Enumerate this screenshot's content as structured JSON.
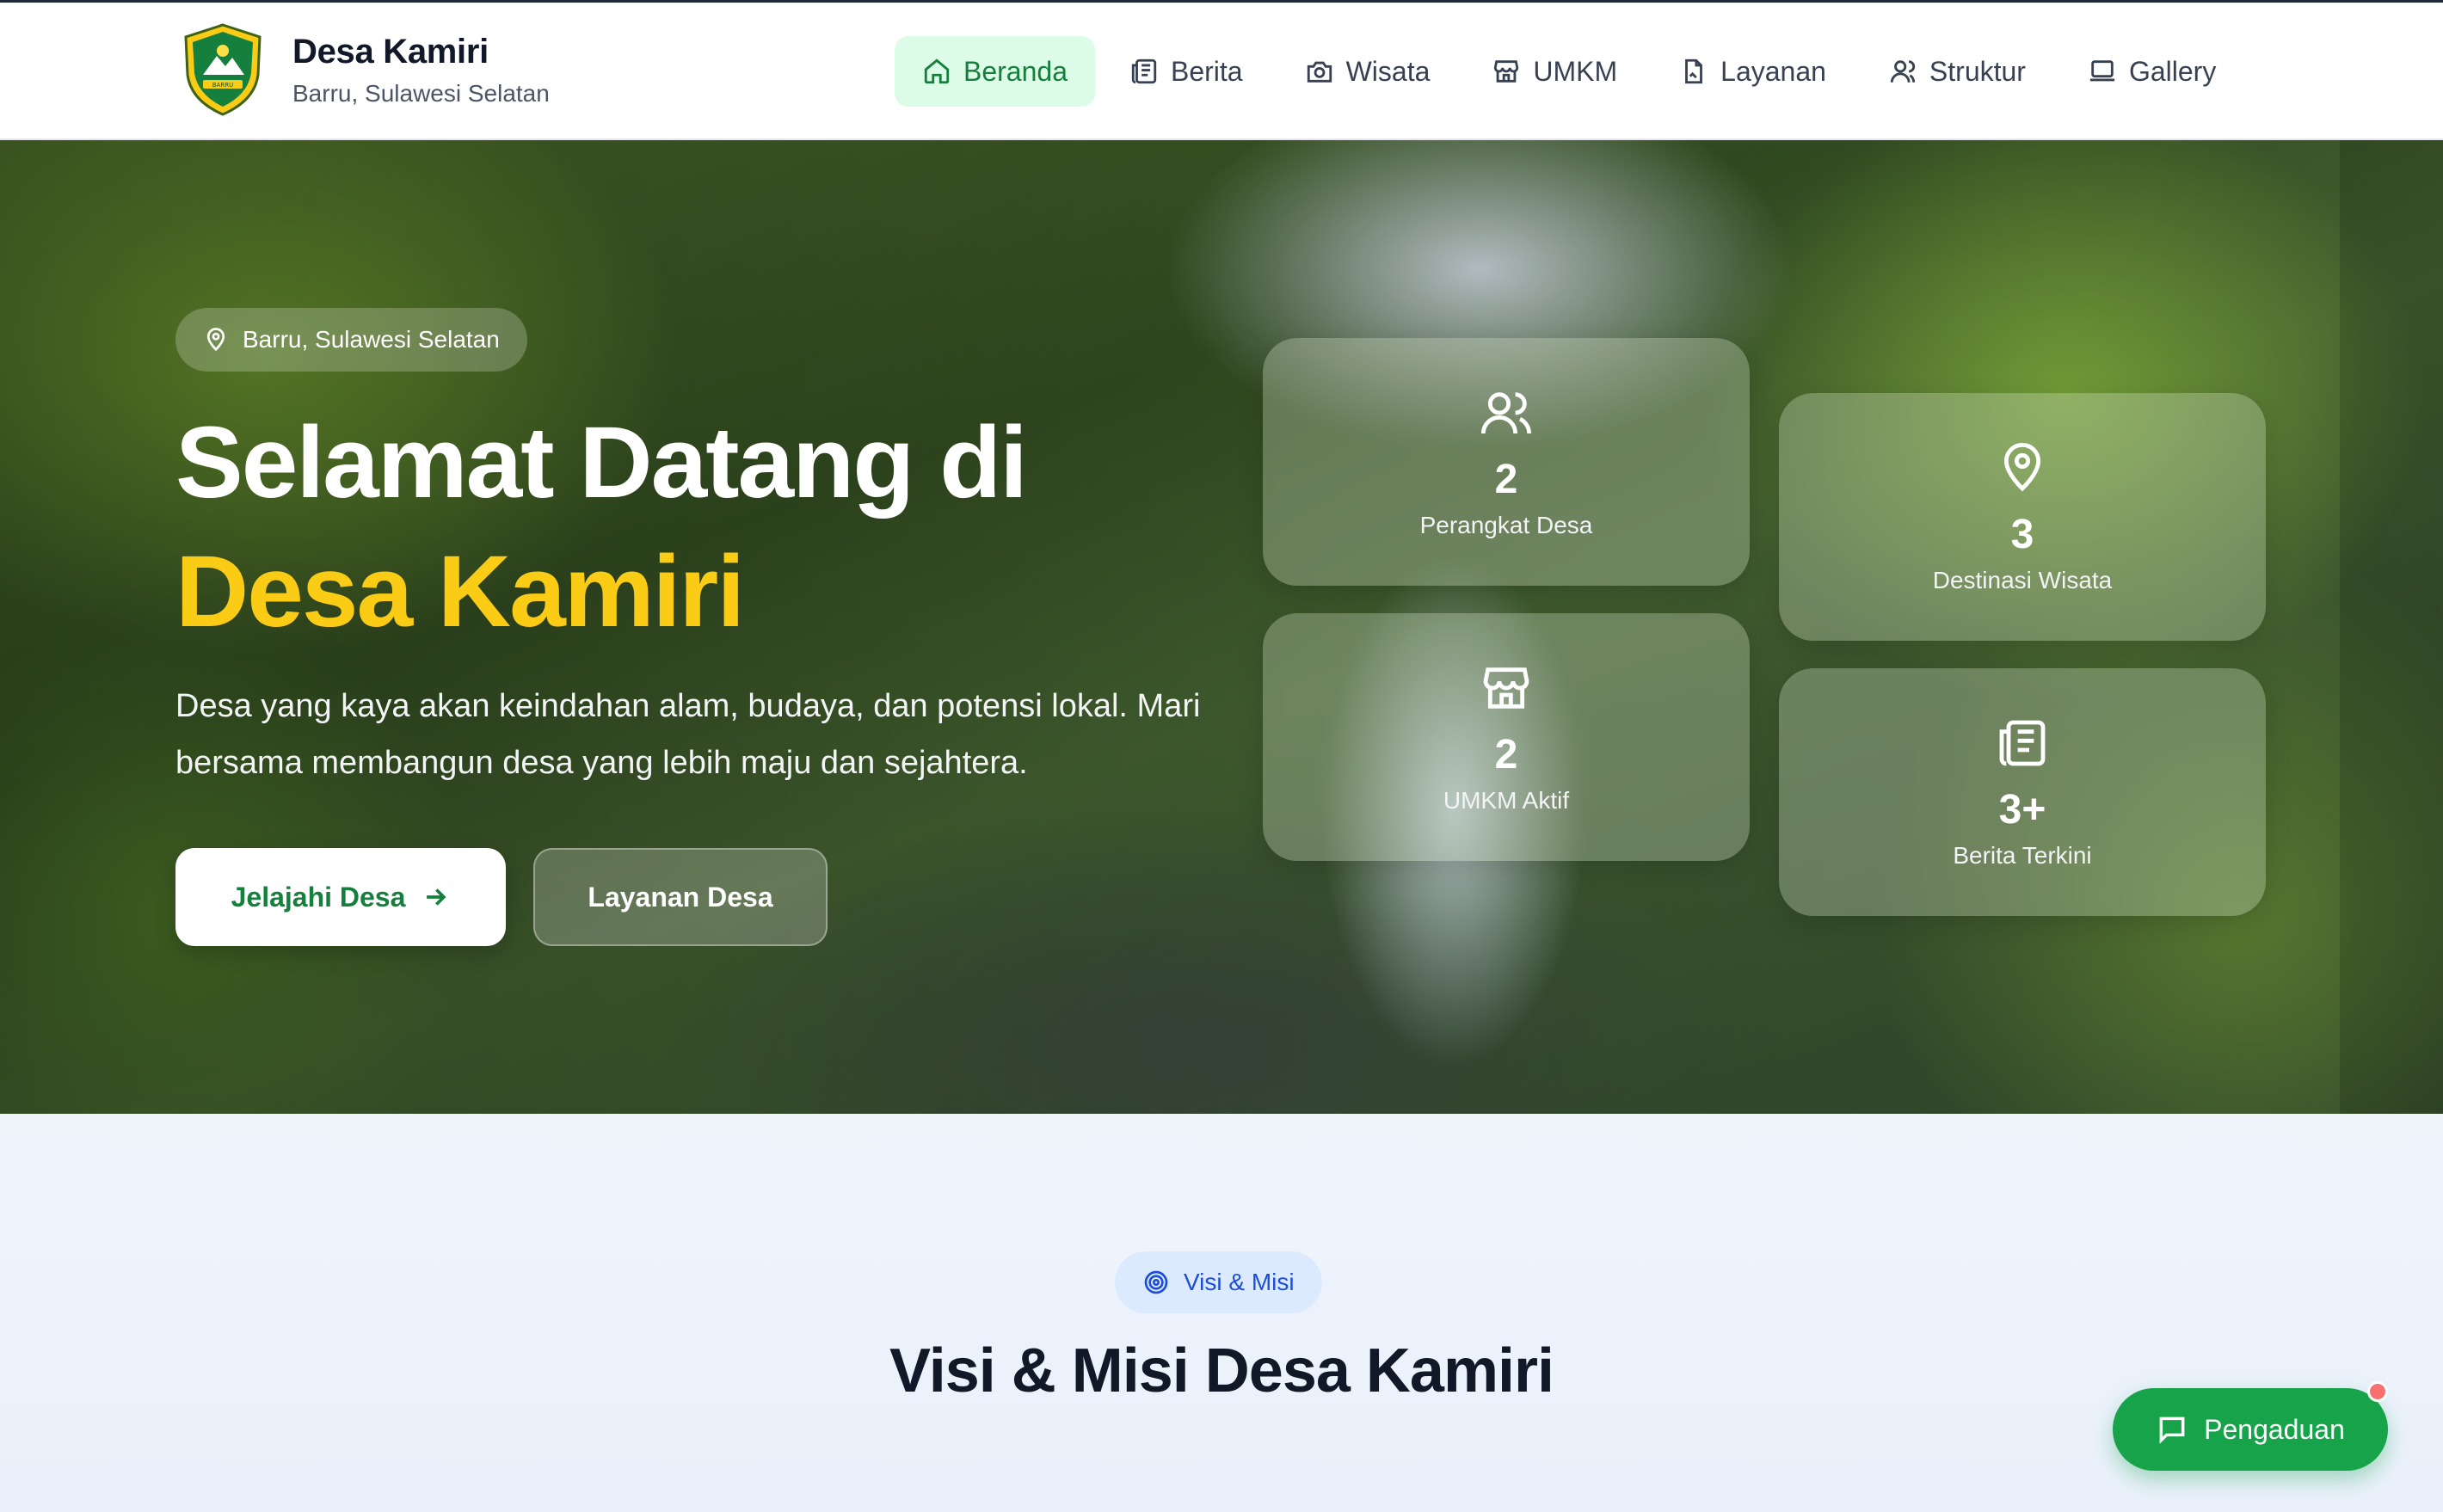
{
  "header": {
    "brand_title": "Desa Kamiri",
    "brand_subtitle": "Barru, Sulawesi Selatan",
    "logo_icon": "village-emblem-icon",
    "logo_text": "BARRU",
    "nav": [
      {
        "label": "Beranda",
        "icon": "home-icon",
        "active": true
      },
      {
        "label": "Berita",
        "icon": "newspaper-icon",
        "active": false
      },
      {
        "label": "Wisata",
        "icon": "camera-icon",
        "active": false
      },
      {
        "label": "UMKM",
        "icon": "store-icon",
        "active": false
      },
      {
        "label": "Layanan",
        "icon": "document-icon",
        "active": false
      },
      {
        "label": "Struktur",
        "icon": "user-icon",
        "active": false
      },
      {
        "label": "Gallery",
        "icon": "monitor-icon",
        "active": false
      }
    ]
  },
  "hero": {
    "location": "Barru, Sulawesi Selatan",
    "title_line1": "Selamat Datang di",
    "title_line2": "Desa Kamiri",
    "description": "Desa yang kaya akan keindahan alam, budaya, dan potensi lokal. Mari bersama membangun desa yang lebih maju dan sejahtera.",
    "primary_button": "Jelajahi Desa",
    "secondary_button": "Layanan Desa",
    "stats": [
      {
        "value": "2",
        "label": "Perangkat Desa",
        "icon": "users-icon"
      },
      {
        "value": "3",
        "label": "Destinasi Wisata",
        "icon": "map-pin-icon"
      },
      {
        "value": "2",
        "label": "UMKM Aktif",
        "icon": "store-icon"
      },
      {
        "value": "3+",
        "label": "Berita Terkini",
        "icon": "newspaper-icon"
      }
    ]
  },
  "visi_misi": {
    "badge": "Visi & Misi",
    "title": "Visi & Misi Desa Kamiri"
  },
  "complaint_button": "Pengaduan",
  "colors": {
    "accent_green": "#16a34a",
    "active_nav_bg": "#dcfce7",
    "title_yellow": "#facc15",
    "badge_blue": "#1d4ed8"
  }
}
